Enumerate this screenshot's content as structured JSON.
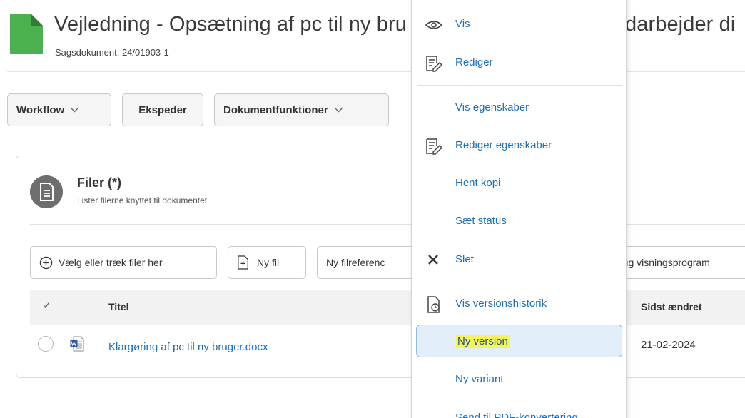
{
  "header": {
    "title_left": "Vejledning - Opsætning af pc til ny bru",
    "title_right": "darbejder di",
    "subtitle": "Sagsdokument: 24/01903-1"
  },
  "toolbar": {
    "workflow_label": "Workflow",
    "ekspeder_label": "Ekspeder",
    "dokumentfunktioner_label": "Dokumentfunktioner"
  },
  "files_panel": {
    "title": "Filer (*)",
    "subtitle": "Lister filerne knyttet til dokumentet",
    "buttons": {
      "choose_files": "Vælg eller træk filer her",
      "new_file": "Ny fil",
      "new_file_reference": "Ny filreferenc",
      "use_viewer": "rug visningsprogram"
    },
    "table": {
      "check_header": "✓",
      "columns": [
        "Titel",
        "Sidst ændret"
      ],
      "rows": [
        {
          "title": "Klargøring af pc til ny bruger.docx",
          "last_changed": "21-02-2024"
        }
      ]
    }
  },
  "context_menu": {
    "items": [
      {
        "label": "Vis",
        "icon": "eye-icon"
      },
      {
        "label": "Rediger",
        "icon": "edit-list-icon"
      },
      {
        "label": "Vis egenskaber",
        "icon": ""
      },
      {
        "label": "Rediger egenskaber",
        "icon": "edit-list-icon"
      },
      {
        "label": "Hent kopi",
        "icon": ""
      },
      {
        "label": "Sæt status",
        "icon": ""
      },
      {
        "label": "Slet",
        "icon": "close-icon"
      },
      {
        "label": "Vis versionshistorik",
        "icon": "file-history-icon"
      },
      {
        "label": "Ny version",
        "icon": "",
        "active": true
      },
      {
        "label": "Ny variant",
        "icon": ""
      },
      {
        "label": "Send til PDF-konvertering",
        "icon": ""
      }
    ]
  },
  "colors": {
    "link": "#1f6fb2",
    "doc_icon_green": "#4caf50",
    "highlight_yellow": "#f3f55a",
    "active_item_bg": "#e3eefb",
    "active_item_border": "#98b9e0"
  }
}
